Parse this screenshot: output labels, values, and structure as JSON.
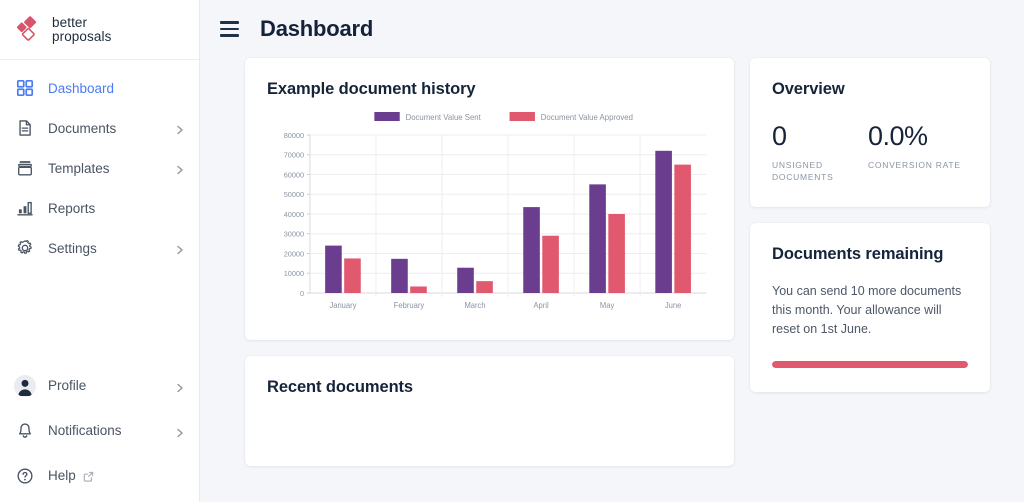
{
  "brand": {
    "name_line1": "better",
    "name_line2": "proposals",
    "accent_pink": "#d9536a",
    "accent_blue": "#4b7bf5"
  },
  "sidebar": {
    "items": [
      {
        "label": "Dashboard",
        "icon": "grid-icon",
        "active": true,
        "chevron": false
      },
      {
        "label": "Documents",
        "icon": "document-icon",
        "active": false,
        "chevron": true
      },
      {
        "label": "Templates",
        "icon": "templates-icon",
        "active": false,
        "chevron": true
      },
      {
        "label": "Reports",
        "icon": "bar-chart-icon",
        "active": false,
        "chevron": false
      },
      {
        "label": "Settings",
        "icon": "gear-icon",
        "active": false,
        "chevron": true
      }
    ],
    "bottom_items": [
      {
        "label": "Profile",
        "icon": "avatar-icon",
        "chevron": true,
        "external": false
      },
      {
        "label": "Notifications",
        "icon": "bell-icon",
        "chevron": true,
        "external": false
      },
      {
        "label": "Help",
        "icon": "question-mark-icon",
        "chevron": false,
        "external": true
      }
    ]
  },
  "header": {
    "title": "Dashboard",
    "menu_icon": "hamburger-icon"
  },
  "chart_card": {
    "title": "Example document history"
  },
  "overview": {
    "title": "Overview",
    "stats": [
      {
        "value": "0",
        "label": "UNSIGNED DOCUMENTS"
      },
      {
        "value": "0.0%",
        "label": "CONVERSION RATE"
      }
    ]
  },
  "documents_remaining": {
    "title": "Documents remaining",
    "body": "You can send 10 more documents this month. Your allowance will reset on 1st June.",
    "progress_percent": 100,
    "progress_color": "#e1596f"
  },
  "recent_documents": {
    "title": "Recent documents"
  },
  "chart_data": {
    "type": "bar",
    "title": "Example document history",
    "categories": [
      "January",
      "February",
      "March",
      "April",
      "May",
      "June"
    ],
    "series": [
      {
        "name": "Document Value Sent",
        "color": "#6b3d8f",
        "values": [
          24000,
          17300,
          12800,
          43500,
          55000,
          72000
        ]
      },
      {
        "name": "Document Value Approved",
        "color": "#e1596f",
        "values": [
          17500,
          3300,
          6000,
          29000,
          40000,
          65000
        ]
      }
    ],
    "ylim": [
      0,
      80000
    ],
    "yticks": [
      0,
      10000,
      20000,
      30000,
      40000,
      50000,
      60000,
      70000,
      80000
    ],
    "ytick_labels": [
      "0",
      "10000",
      "20000",
      "30000",
      "40000",
      "50000",
      "60000",
      "70000",
      "80000"
    ],
    "xlabel": "",
    "ylabel": "",
    "grid": true,
    "legend_position": "top"
  }
}
